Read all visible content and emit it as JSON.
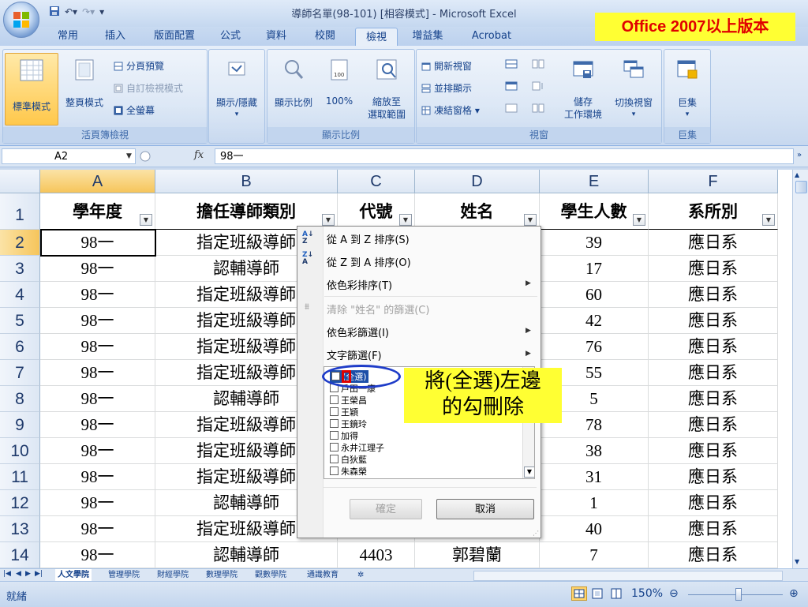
{
  "window": {
    "title": "導師名單(98-101) [相容模式] - Microsoft Excel",
    "version_note": "Office 2007以上版本"
  },
  "tabs": [
    "常用",
    "插入",
    "版面配置",
    "公式",
    "資料",
    "校閱",
    "檢視",
    "增益集",
    "Acrobat"
  ],
  "active_tab": "檢視",
  "ribbon": {
    "workbook_views": {
      "label": "活頁簿檢視",
      "normal": "標準模式",
      "page_layout": "整頁模式",
      "page_break": "分頁預覽",
      "custom_views": "自訂檢視模式",
      "full_screen": "全螢幕"
    },
    "show_hide": {
      "label": "顯示/隱藏"
    },
    "zoom": {
      "label": "顯示比例",
      "zoom": "顯示比例",
      "hundred": "100%",
      "selection_line1": "縮放至",
      "selection_line2": "選取範圍"
    },
    "window": {
      "label": "視窗",
      "new_window": "開新視窗",
      "arrange_all": "並排顯示",
      "freeze_panes": "凍結窗格",
      "save_workspace_line1": "儲存",
      "save_workspace_line2": "工作環境",
      "switch_windows": "切換視窗"
    },
    "macros": {
      "label": "巨集",
      "button": "巨集"
    }
  },
  "formula_bar": {
    "name_box": "A2",
    "fx": "fx",
    "formula": "98一"
  },
  "grid": {
    "columns": [
      "A",
      "B",
      "C",
      "D",
      "E",
      "F"
    ],
    "headers": [
      "學年度",
      "擔任導師類別",
      "代號",
      "姓名",
      "學生人數",
      "系所別"
    ],
    "rows": [
      {
        "n": "2",
        "a": "98一",
        "b": "指定班級導師",
        "c": "",
        "d": "",
        "e": "39",
        "f": "應日系"
      },
      {
        "n": "3",
        "a": "98一",
        "b": "認輔導師",
        "c": "",
        "d": "",
        "e": "17",
        "f": "應日系"
      },
      {
        "n": "4",
        "a": "98一",
        "b": "指定班級導師",
        "c": "",
        "d": "",
        "e": "60",
        "f": "應日系"
      },
      {
        "n": "5",
        "a": "98一",
        "b": "指定班級導師",
        "c": "",
        "d": "",
        "e": "42",
        "f": "應日系"
      },
      {
        "n": "6",
        "a": "98一",
        "b": "指定班級導師",
        "c": "",
        "d": "",
        "e": "76",
        "f": "應日系"
      },
      {
        "n": "7",
        "a": "98一",
        "b": "指定班級導師",
        "c": "",
        "d": "",
        "e": "55",
        "f": "應日系"
      },
      {
        "n": "8",
        "a": "98一",
        "b": "認輔導師",
        "c": "",
        "d": "",
        "e": "5",
        "f": "應日系"
      },
      {
        "n": "9",
        "a": "98一",
        "b": "指定班級導師",
        "c": "",
        "d": "",
        "e": "78",
        "f": "應日系"
      },
      {
        "n": "10",
        "a": "98一",
        "b": "指定班級導師",
        "c": "",
        "d": "",
        "e": "38",
        "f": "應日系"
      },
      {
        "n": "11",
        "a": "98一",
        "b": "指定班級導師",
        "c": "",
        "d": "",
        "e": "31",
        "f": "應日系"
      },
      {
        "n": "12",
        "a": "98一",
        "b": "認輔導師",
        "c": "",
        "d": "",
        "e": "1",
        "f": "應日系"
      },
      {
        "n": "13",
        "a": "98一",
        "b": "指定班級導師",
        "c": "",
        "d": "",
        "e": "40",
        "f": "應日系"
      },
      {
        "n": "14",
        "a": "98一",
        "b": "認輔導師",
        "c": "4403",
        "d": "郭碧蘭",
        "e": "7",
        "f": "應日系"
      }
    ],
    "header_row_number": "1"
  },
  "filter_menu": {
    "sort_az": "從 A 到 Z 排序(S)",
    "sort_za": "從 Z 到 A 排序(O)",
    "sort_by_color": "依色彩排序(T)",
    "clear_filter": "清除 \"姓名\" 的篩選(C)",
    "filter_by_color": "依色彩篩選(I)",
    "text_filters": "文字篩選(F)",
    "items": [
      "(全選)",
      "戶田一康",
      "王榮昌",
      "王穎",
      "王鏡玲",
      "加得",
      "永井江理子",
      "白狄藍",
      "朱森榮"
    ],
    "ok": "確定",
    "cancel": "取消"
  },
  "annotation": {
    "line1": "將(全選)左邊",
    "line2": "的勾刪除"
  },
  "sheet_tabs": [
    "人文學院",
    "管理學院",
    "財經學院",
    "數理學院",
    "觀數學院",
    "通識教育"
  ],
  "status": {
    "text": "就緒",
    "zoom": "150%"
  },
  "colors": {
    "accent": "#15428b",
    "ribbon_bg": "#d7e4f4",
    "selection": "#f6c55b",
    "annotation": "#ffff33"
  }
}
